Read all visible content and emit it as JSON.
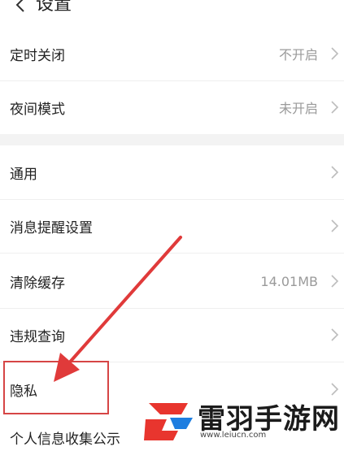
{
  "header": {
    "title": "设置"
  },
  "group1": [
    {
      "label": "定时关闭",
      "value": "不开启"
    },
    {
      "label": "夜间模式",
      "value": "未开启"
    }
  ],
  "group2": [
    {
      "label": "通用",
      "value": ""
    },
    {
      "label": "消息提醒设置",
      "value": ""
    },
    {
      "label": "清除缓存",
      "value": "14.01MB"
    },
    {
      "label": "违规查询",
      "value": ""
    },
    {
      "label": "隐私",
      "value": ""
    },
    {
      "label": "个人信息收集公示",
      "value": ""
    }
  ],
  "watermark": {
    "text": "雷羽手游网",
    "url": "www.leiucn.com"
  },
  "colors": {
    "highlight": "#d64545",
    "arrow": "#e03a3a",
    "logo_red": "#e8352e",
    "logo_blue": "#1e7ee0"
  }
}
